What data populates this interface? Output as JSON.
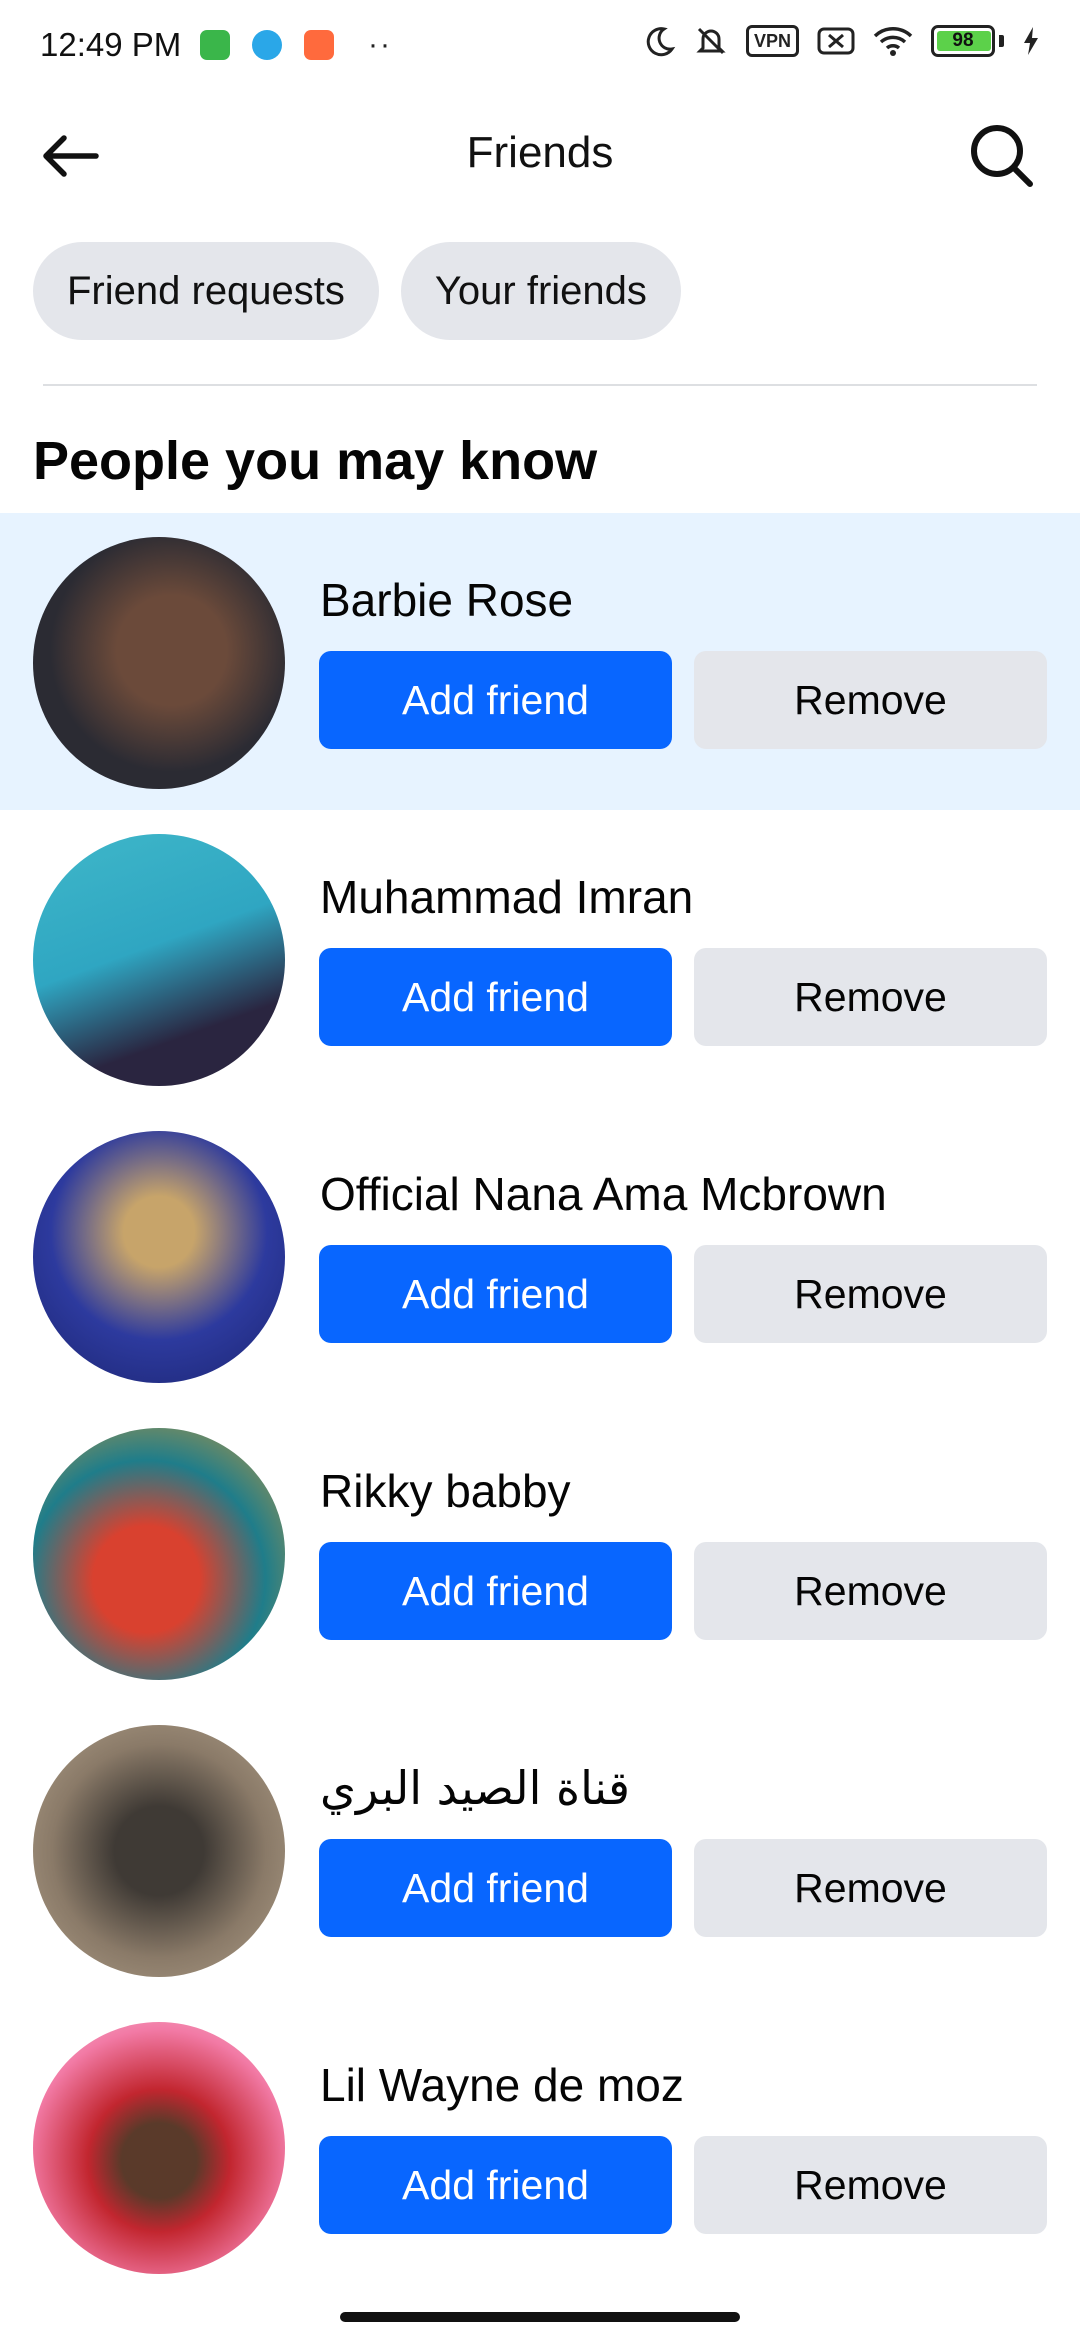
{
  "status_bar": {
    "time": "12:49 PM",
    "dots": "··",
    "vpn_label": "VPN",
    "battery_level": "98",
    "left_icons": [
      "android-app-icon",
      "blue-app-icon",
      "orange-app-icon"
    ],
    "right_icons": [
      "moon-icon",
      "bell-muted-icon",
      "vpn-icon",
      "signal-off-icon",
      "wifi-icon",
      "battery-icon",
      "charging-icon"
    ]
  },
  "header": {
    "title": "Friends",
    "back_icon": "arrow-left-icon",
    "search_icon": "search-icon"
  },
  "chips": [
    {
      "label": "Friend requests"
    },
    {
      "label": "Your friends"
    }
  ],
  "section_title": "People you may know",
  "people": [
    {
      "name": "Barbie Rose",
      "add_label": "Add friend",
      "remove_label": "Remove",
      "avatar_colors": [
        "#2b2b33",
        "#6b4a3a"
      ]
    },
    {
      "name": "Muhammad Imran",
      "add_label": "Add friend",
      "remove_label": "Remove",
      "avatar_colors": [
        "#3fb7c9",
        "#2a2540"
      ]
    },
    {
      "name": "Official Nana Ama Mcbrown",
      "add_label": "Add friend",
      "remove_label": "Remove",
      "avatar_colors": [
        "#2d3a9e",
        "#c7a46a"
      ]
    },
    {
      "name": "Rikky babby",
      "add_label": "Add friend",
      "remove_label": "Remove",
      "avatar_colors": [
        "#1f7d8a",
        "#d9412f"
      ]
    },
    {
      "name": "قناة الصيد البري",
      "add_label": "Add friend",
      "remove_label": "Remove",
      "avatar_colors": [
        "#8a7a68",
        "#3f3a35"
      ]
    },
    {
      "name": "Lil Wayne de moz",
      "add_label": "Add friend",
      "remove_label": "Remove",
      "avatar_colors": [
        "#f27aa5",
        "#c2262f"
      ]
    }
  ],
  "colors": {
    "primary": "#0866ff",
    "highlight_row": "#e7f3ff",
    "chip_bg": "#e4e6eb"
  }
}
